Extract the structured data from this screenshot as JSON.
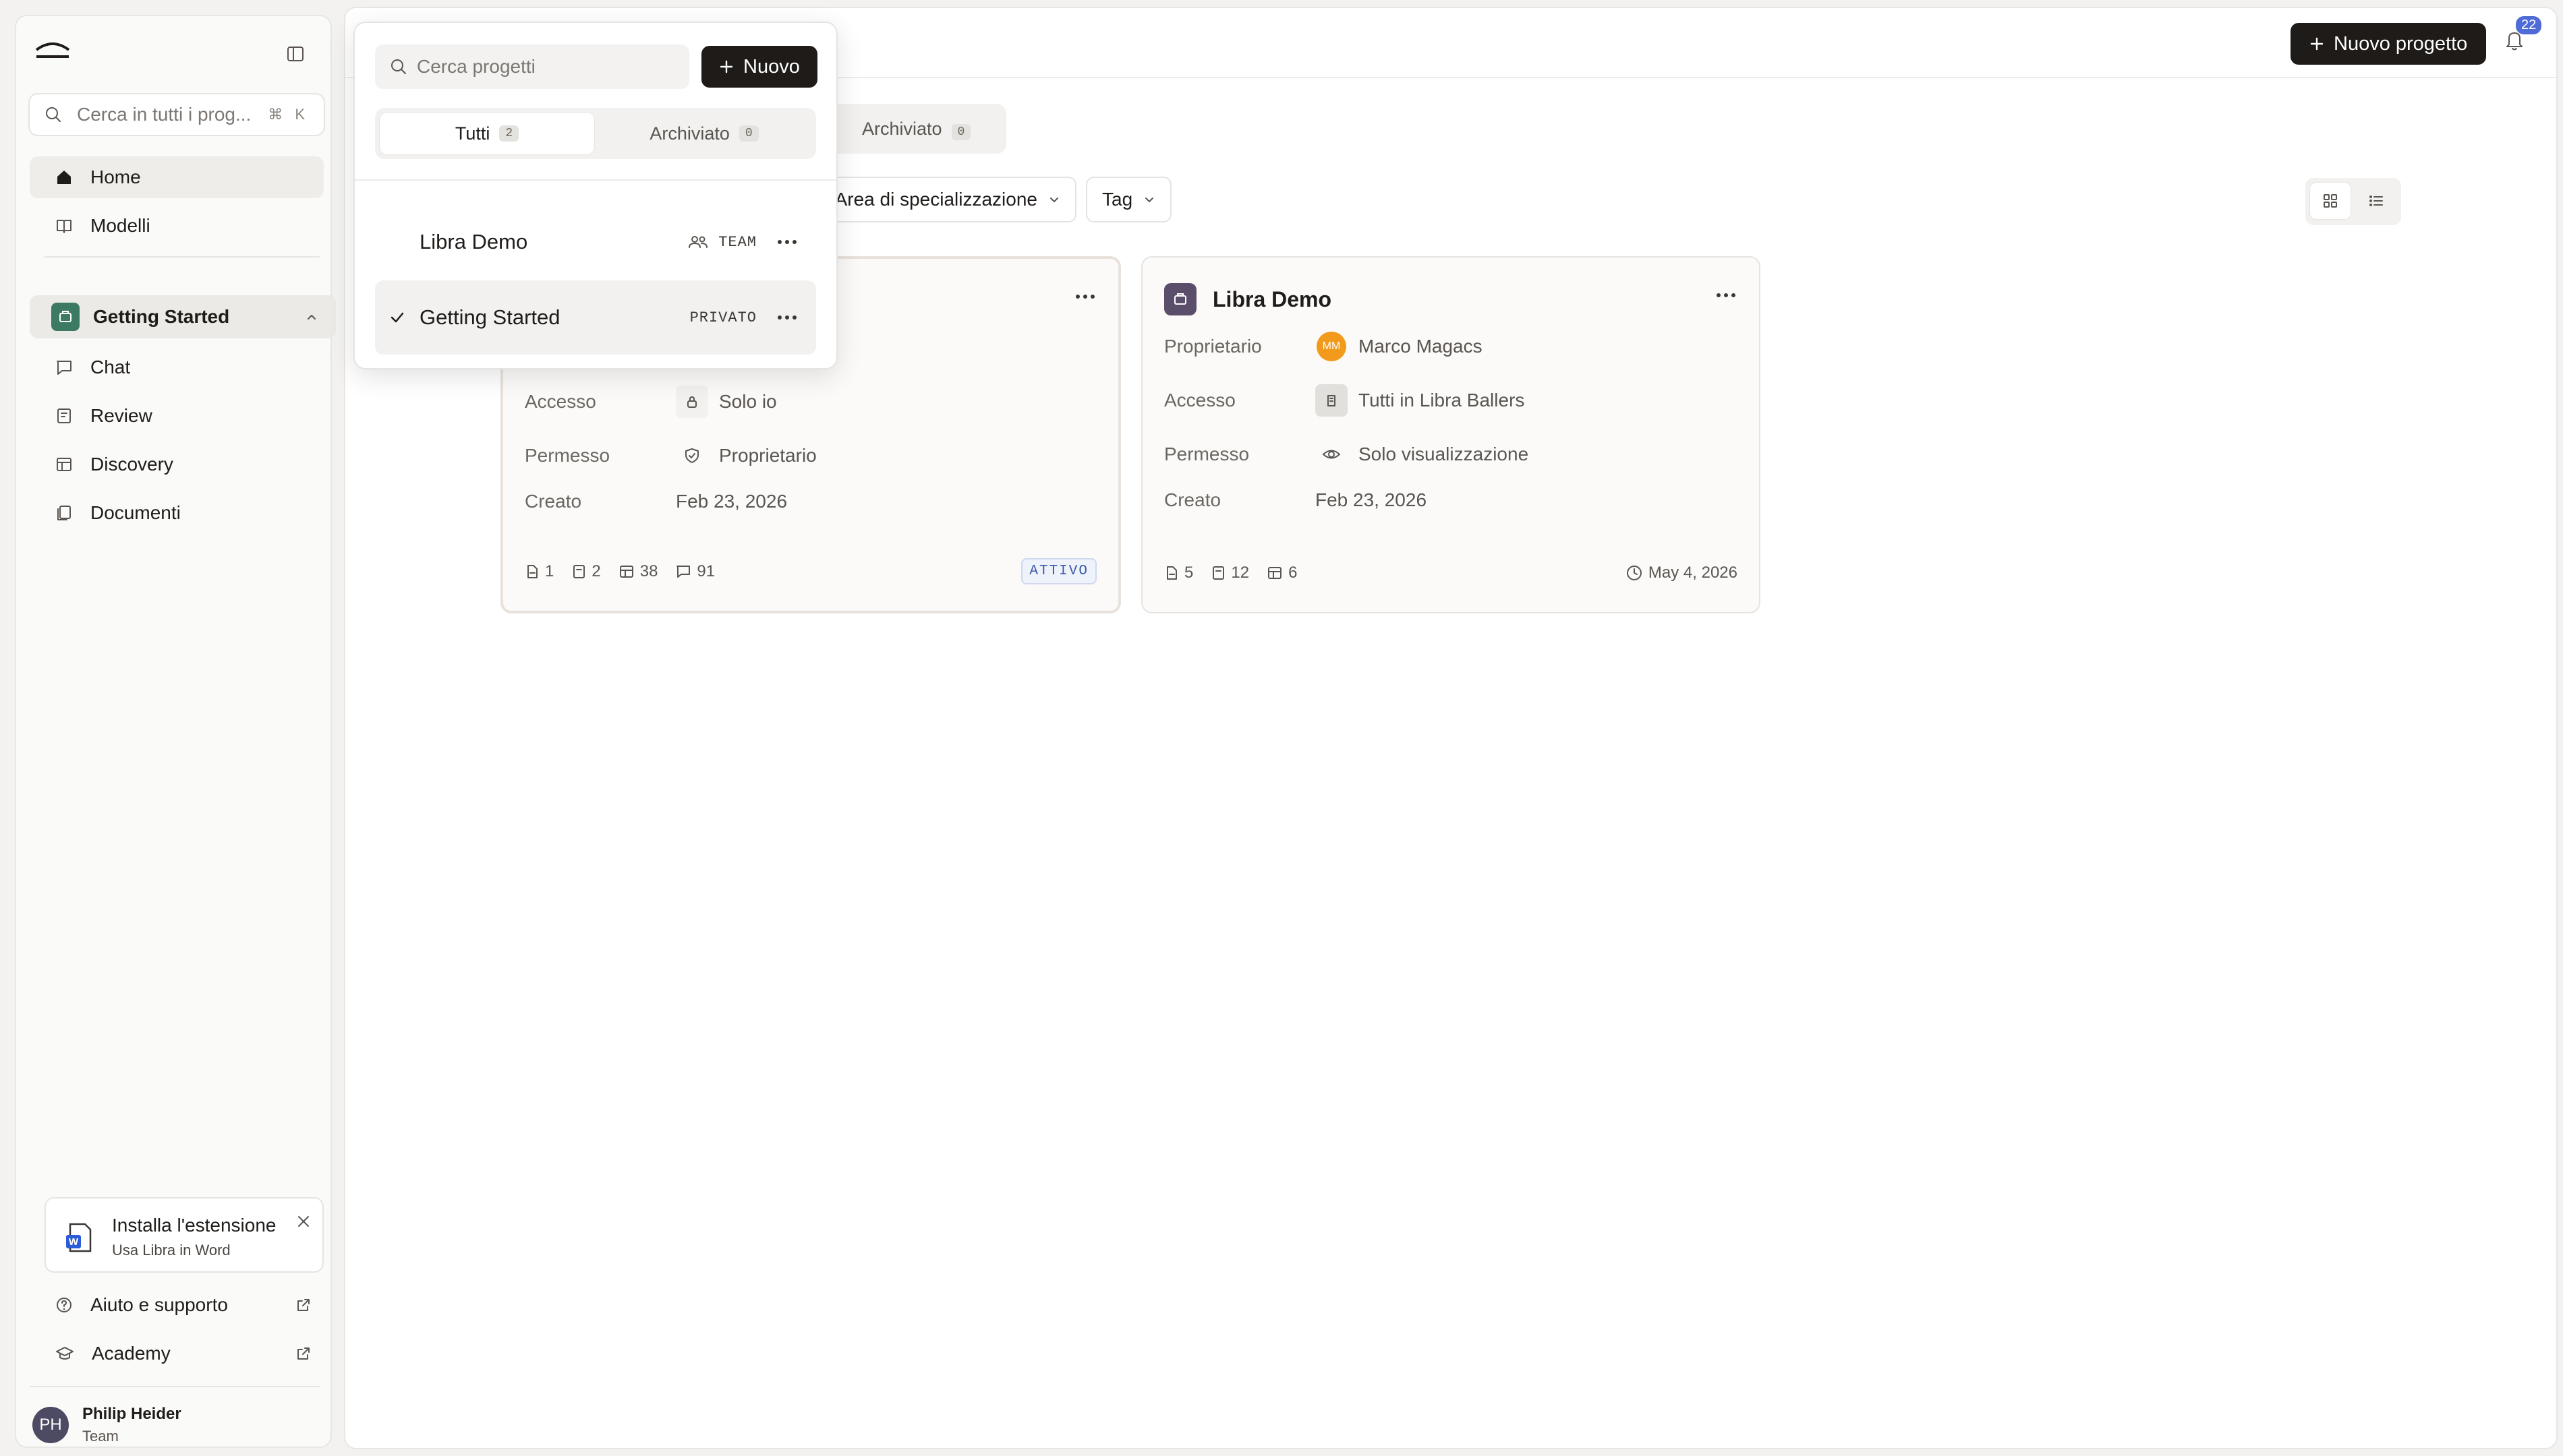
{
  "sidebar": {
    "search_placeholder": "Cerca in tutti i prog...",
    "search_shortcut": "⌘ K",
    "nav": [
      {
        "label": "Home"
      },
      {
        "label": "Modelli"
      }
    ],
    "project": {
      "label": "Getting Started"
    },
    "project_nav": [
      {
        "label": "Chat"
      },
      {
        "label": "Review"
      },
      {
        "label": "Discovery"
      },
      {
        "label": "Documenti"
      }
    ],
    "promo": {
      "title": "Installa l'estensione",
      "subtitle": "Usa Libra in Word"
    },
    "footer": [
      {
        "label": "Aiuto e supporto"
      },
      {
        "label": "Academy"
      }
    ],
    "user": {
      "initials": "PH",
      "name": "Philip Heider",
      "role": "Team"
    }
  },
  "topbar": {
    "new_project_label": "Nuovo progetto",
    "notification_count": "22"
  },
  "main": {
    "tab_archived": {
      "label": "Archiviato",
      "count": "0"
    },
    "filters": [
      {
        "label": "Area di specializzazione"
      },
      {
        "label": "Tag"
      }
    ],
    "cards": [
      {
        "name": "Getting Started",
        "rows": [
          {
            "key": "Accesso",
            "value": "Solo io"
          },
          {
            "key": "Permesso",
            "value": "Proprietario"
          },
          {
            "key": "Creato",
            "value": "Feb 23, 2026"
          }
        ],
        "stats": [
          "1",
          "2",
          "38",
          "91"
        ],
        "status": "ATTIVO"
      },
      {
        "name": "Libra Demo",
        "rows": [
          {
            "key": "Proprietario",
            "value": "Marco Magacs",
            "initials": "MM"
          },
          {
            "key": "Accesso",
            "value": "Tutti in Libra Ballers"
          },
          {
            "key": "Permesso",
            "value": "Solo visualizzazione"
          },
          {
            "key": "Creato",
            "value": "Feb 23, 2026"
          }
        ],
        "stats": [
          "5",
          "12",
          "6"
        ],
        "date": "May 4, 2026"
      }
    ]
  },
  "dropdown": {
    "search_placeholder": "Cerca progetti",
    "new_label": "Nuovo",
    "tabs": [
      {
        "label": "Tutti",
        "count": "2"
      },
      {
        "label": "Archiviato",
        "count": "0"
      }
    ],
    "items": [
      {
        "name": "Libra Demo",
        "tag": "TEAM"
      },
      {
        "name": "Getting Started",
        "tag": "PRIVATO"
      }
    ]
  }
}
